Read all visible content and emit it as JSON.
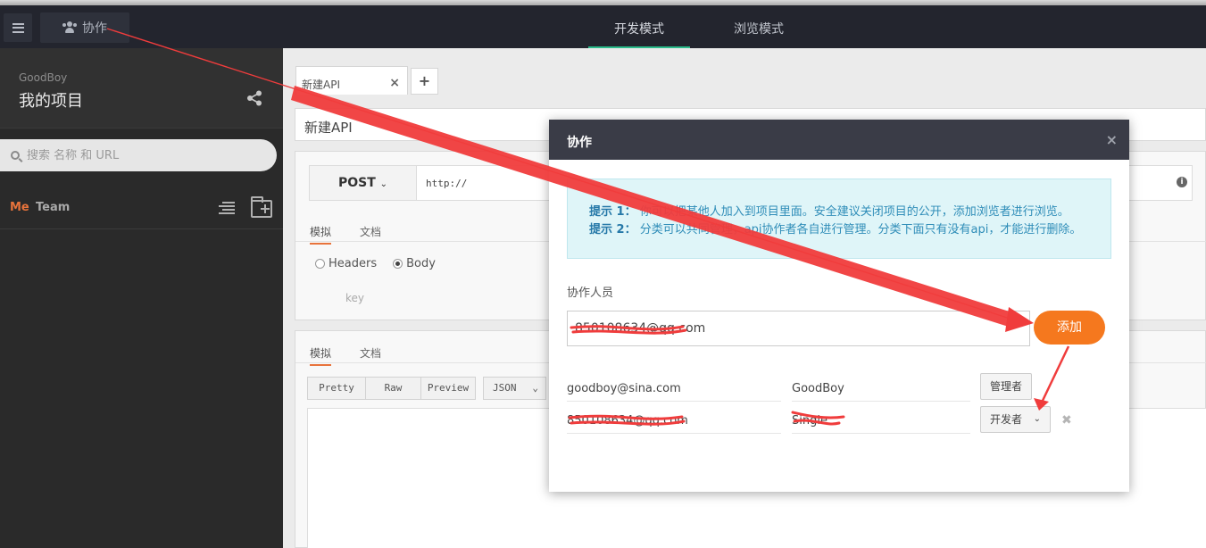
{
  "header": {
    "collab_label": "协作",
    "mode_dev": "开发模式",
    "mode_browse": "浏览模式",
    "accent_color": "#2cbc8c"
  },
  "sidebar": {
    "username": "GoodBoy",
    "project_title": "我的项目",
    "search_placeholder": "搜索 名称 和 URL",
    "tab_me": "Me",
    "tab_team": "Team"
  },
  "main": {
    "tab_label": "新建API",
    "tab_close": "×",
    "tab_add": "+",
    "api_name": "新建API",
    "method": "POST",
    "url": "http://",
    "req_tabs": [
      "模拟",
      "文档"
    ],
    "radio_headers": "Headers",
    "radio_body": "Body",
    "key_placeholder": "key",
    "resp_tabs": [
      "模拟",
      "文档"
    ],
    "format_buttons": [
      "Pretty",
      "Raw",
      "Preview"
    ],
    "format_select": "JSON"
  },
  "modal": {
    "title": "协作",
    "close": "×",
    "tip1_label": "提示 1：",
    "tip1_text": "你可以把某他人加入到项目里面。安全建议关闭项目的公开，添加浏览者进行浏览。",
    "tip2_label": "提示 2：",
    "tip2_text": "分类可以共同管理，api协作者各自进行管理。分类下面只有没有api，才能进行删除。",
    "collaborators_label": "协作人员",
    "email_value": "850108634@qq.com",
    "add_button": "添加",
    "add_color": "#f5781e",
    "members": [
      {
        "email": "goodboy@sina.com",
        "name": "GoodBoy",
        "role": "管理者"
      },
      {
        "email": "850108634@qq.com",
        "name": "Single",
        "role": "开发者"
      }
    ],
    "remove": "✖"
  }
}
